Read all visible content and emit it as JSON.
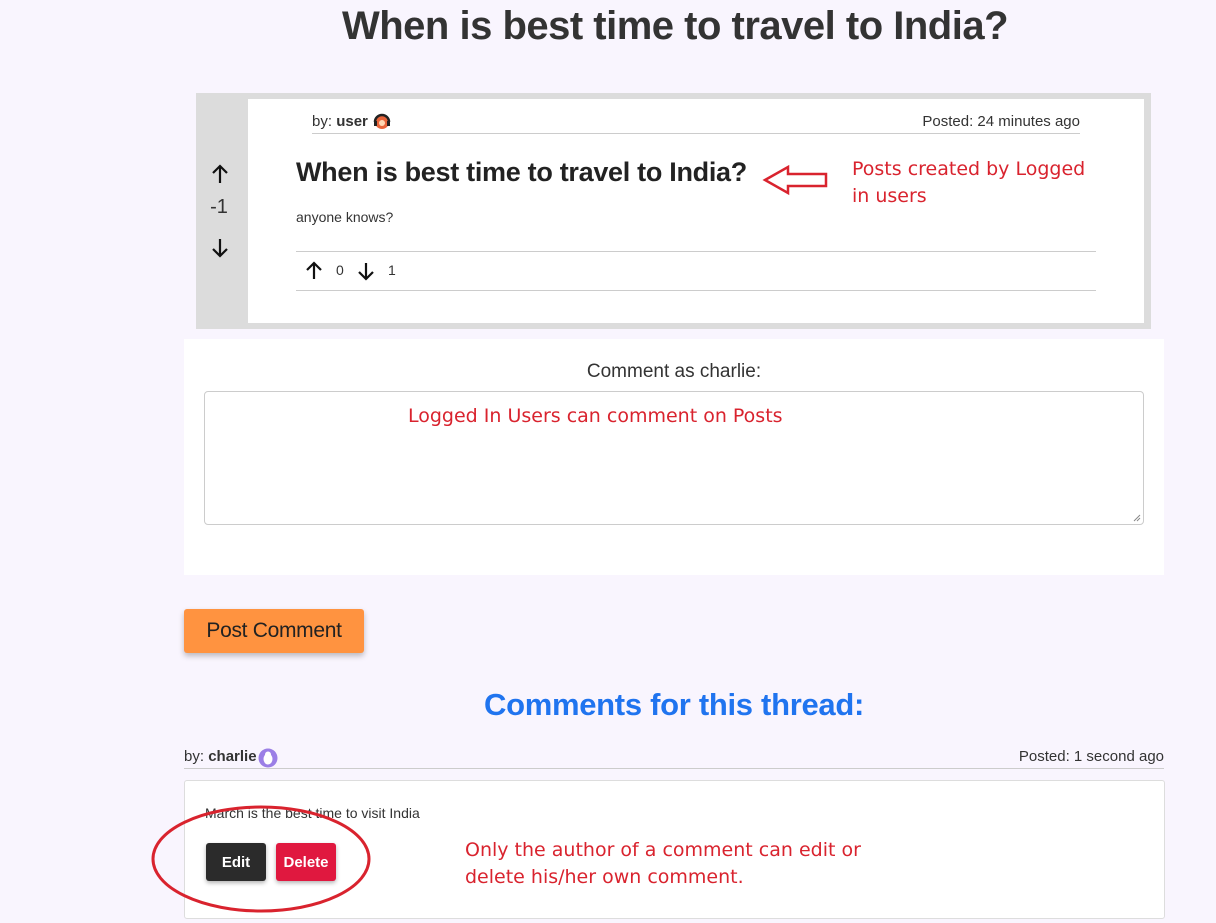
{
  "page": {
    "title": "When is best time to travel to India?"
  },
  "post": {
    "vote_score": "-1",
    "author_prefix": "by:",
    "author_name": "user",
    "posted": "Posted: 24 minutes ago",
    "heading": "When is best time to travel to India?",
    "body": "anyone knows?",
    "upvotes": "0",
    "downvotes": "1"
  },
  "comment_form": {
    "label": "Comment as charlie:",
    "submit_label": "Post Comment"
  },
  "comments": {
    "heading": "Comments for this thread:",
    "items": [
      {
        "author_prefix": "by:",
        "author_name": "charlie",
        "posted": "Posted: 1 second ago",
        "text": "March is the best time to visit India",
        "edit_label": "Edit",
        "delete_label": "Delete"
      }
    ]
  },
  "annotations": {
    "posts": "Posts created by Logged in users",
    "comment": "Logged In Users can comment on Posts",
    "author": "Only the author of a comment can edit or delete his/her own comment."
  },
  "colors": {
    "accent_orange": "#ff9340",
    "heading_blue": "#2074ef",
    "annotation_red": "#d9232e",
    "delete_red": "#e0183f"
  }
}
